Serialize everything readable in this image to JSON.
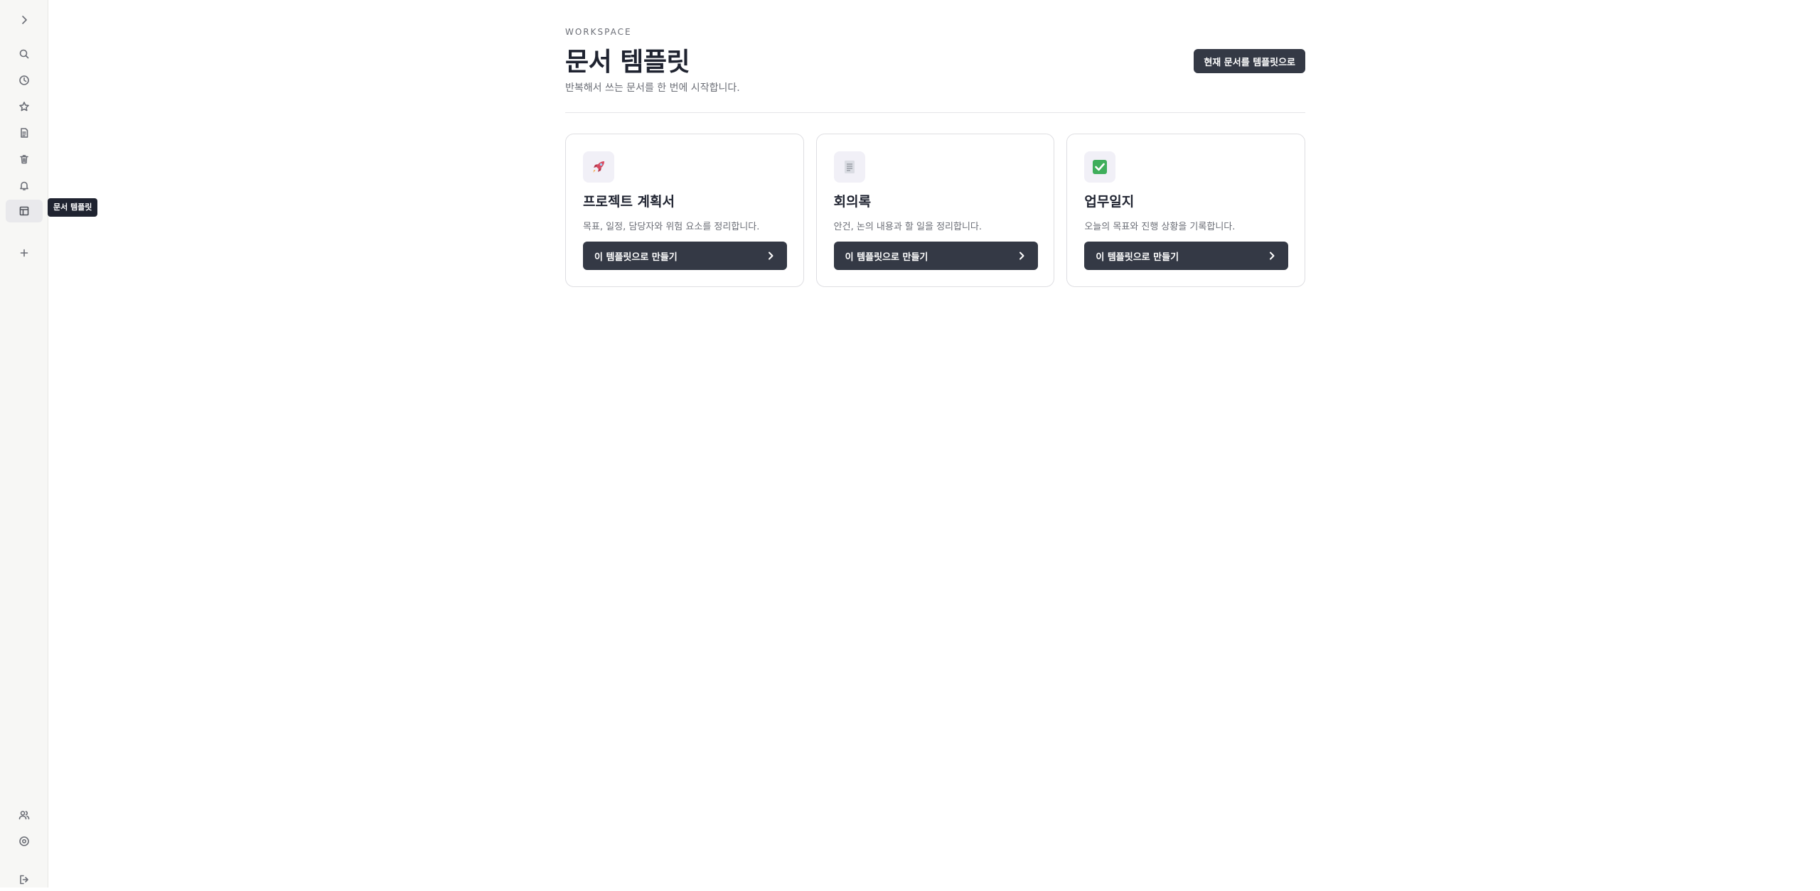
{
  "sidebar": {
    "tooltip": "문서 템플릿",
    "items": [
      {
        "icon": "chevron-right-icon",
        "label": "expand sidebar"
      },
      {
        "icon": "search-icon",
        "label": "search"
      },
      {
        "icon": "clock-icon",
        "label": "recent"
      },
      {
        "icon": "star-icon",
        "label": "favorites"
      },
      {
        "icon": "document-icon",
        "label": "documents"
      },
      {
        "icon": "trash-icon",
        "label": "trash"
      },
      {
        "icon": "bell-icon",
        "label": "notifications"
      },
      {
        "icon": "template-icon",
        "label": "문서 템플릿"
      },
      {
        "icon": "plus-icon",
        "label": "new"
      },
      {
        "icon": "users-icon",
        "label": "members"
      },
      {
        "icon": "settings-icon",
        "label": "settings"
      },
      {
        "icon": "logout-icon",
        "label": "logout"
      }
    ]
  },
  "header": {
    "eyebrow": "WORKSPACE",
    "title": "문서 템플릿",
    "subtitle": "반복해서 쓰는 문서를 한 번에 시작합니다.",
    "save_as_template_label": "현재 문서를 템플릿으로"
  },
  "templates": [
    {
      "icon": "rocket-icon",
      "title": "프로젝트 계획서",
      "description": "목표, 일정, 담당자와 위험 요소를 정리합니다.",
      "button_label": "이 템플릿으로 만들기"
    },
    {
      "icon": "memo-icon",
      "title": "회의록",
      "description": "안건, 논의 내용과 할 일을 정리합니다.",
      "button_label": "이 템플릿으로 만들기"
    },
    {
      "icon": "check-icon",
      "title": "업무일지",
      "description": "오늘의 목표와 진행 상황을 기록합니다.",
      "button_label": "이 템플릿으로 만들기"
    }
  ],
  "colors": {
    "primary_button": "#343945",
    "sidebar_bg": "#f7f7f5",
    "text_muted": "#6b6e76",
    "check_green": "#3fae5b",
    "rocket_red": "#d9485f"
  }
}
